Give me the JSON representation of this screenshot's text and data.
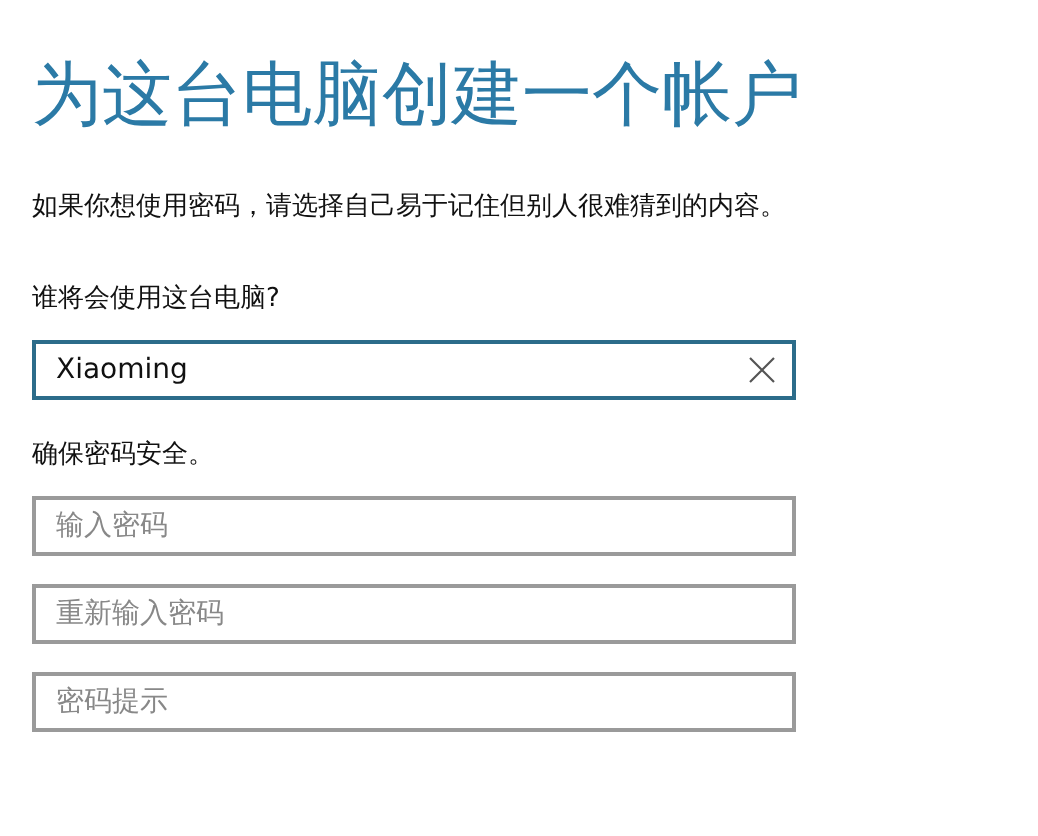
{
  "title": "为这台电脑创建一个帐户",
  "description": "如果你想使用密码，请选择自己易于记住但别人很难猜到的内容。",
  "name_section": {
    "label": "谁将会使用这台电脑?",
    "field": {
      "value": "Xiaoming",
      "focused": true
    }
  },
  "password_section": {
    "label": "确保密码安全。",
    "fields": [
      {
        "placeholder": "输入密码",
        "focused": false
      },
      {
        "placeholder": "重新输入密码",
        "focused": false
      },
      {
        "placeholder": "密码提示",
        "focused": false
      }
    ]
  }
}
